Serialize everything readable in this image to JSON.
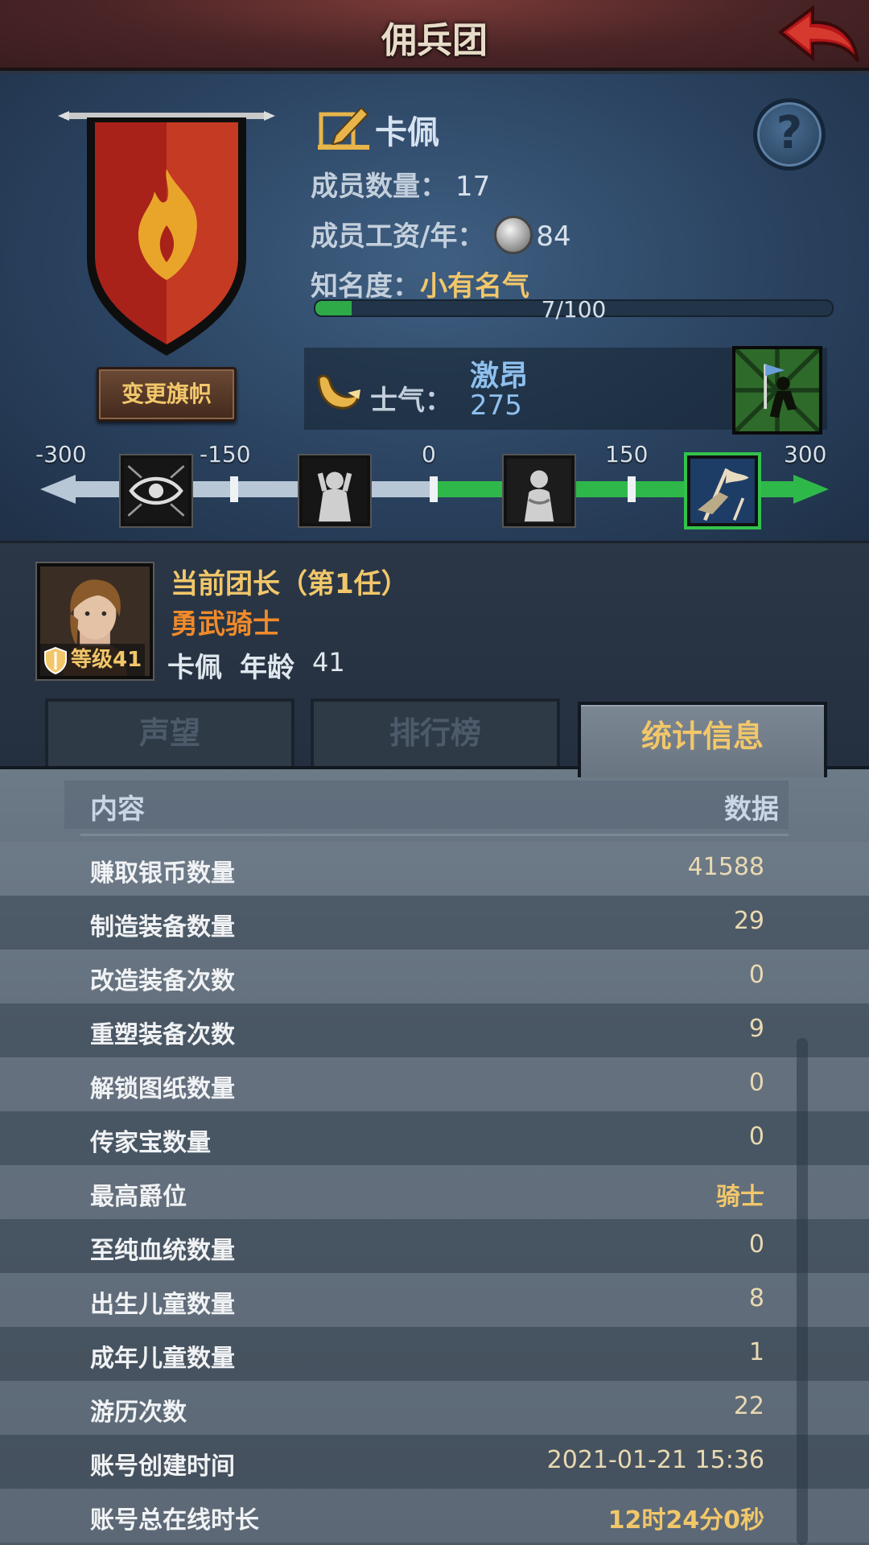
{
  "header": {
    "title": "佣兵团"
  },
  "team": {
    "name": "卡佩",
    "member_count_label": "成员数量：",
    "member_count": "17",
    "salary_label": "成员工资/年：",
    "salary": "84",
    "fame_label": "知名度：",
    "fame_level": "小有名气",
    "fame_progress_text": "7/100",
    "fame_progress": 0.07,
    "change_banner_label": "变更旗帜"
  },
  "morale": {
    "label": "士气：",
    "state": "激昂",
    "value": "275",
    "scale_ticks": [
      "-300",
      "-150",
      "0",
      "150",
      "300"
    ]
  },
  "leader": {
    "title": "当前团长（第1任）",
    "trait": "勇武骑士",
    "name": "卡佩",
    "age_label": "年龄",
    "age": "41",
    "level_text": "等级41"
  },
  "tabs": [
    {
      "label": "声望"
    },
    {
      "label": "排行榜"
    },
    {
      "label": "统计信息"
    }
  ],
  "stats": {
    "header_content": "内容",
    "header_data": "数据",
    "rows": [
      {
        "label": "赚取银币数量",
        "value": "41588"
      },
      {
        "label": "制造装备数量",
        "value": "29"
      },
      {
        "label": "改造装备次数",
        "value": "0"
      },
      {
        "label": "重塑装备次数",
        "value": "9"
      },
      {
        "label": "解锁图纸数量",
        "value": "0"
      },
      {
        "label": "传家宝数量",
        "value": "0"
      },
      {
        "label": "最高爵位",
        "value": "骑士"
      },
      {
        "label": "至纯血统数量",
        "value": "0"
      },
      {
        "label": "出生儿童数量",
        "value": "8"
      },
      {
        "label": "成年儿童数量",
        "value": "1"
      },
      {
        "label": "游历次数",
        "value": "22"
      },
      {
        "label": "账号创建时间",
        "value": "2021-01-21 15:36"
      },
      {
        "label": "账号总在线时长",
        "value": "12时24分0秒"
      }
    ]
  },
  "colors": {
    "accent_gold": "#f2c76a",
    "trait_orange": "#f08a2a",
    "morale_blue": "#8fc0ef",
    "progress_green": "#2faa48",
    "banner_red": "#b8261a"
  },
  "icons": {
    "back": "back-arrow-icon",
    "help": "help-icon",
    "edit": "edit-name-icon",
    "coin": "silver-coin-icon",
    "horn": "horn-icon",
    "banner": "fire-banner-icon"
  }
}
